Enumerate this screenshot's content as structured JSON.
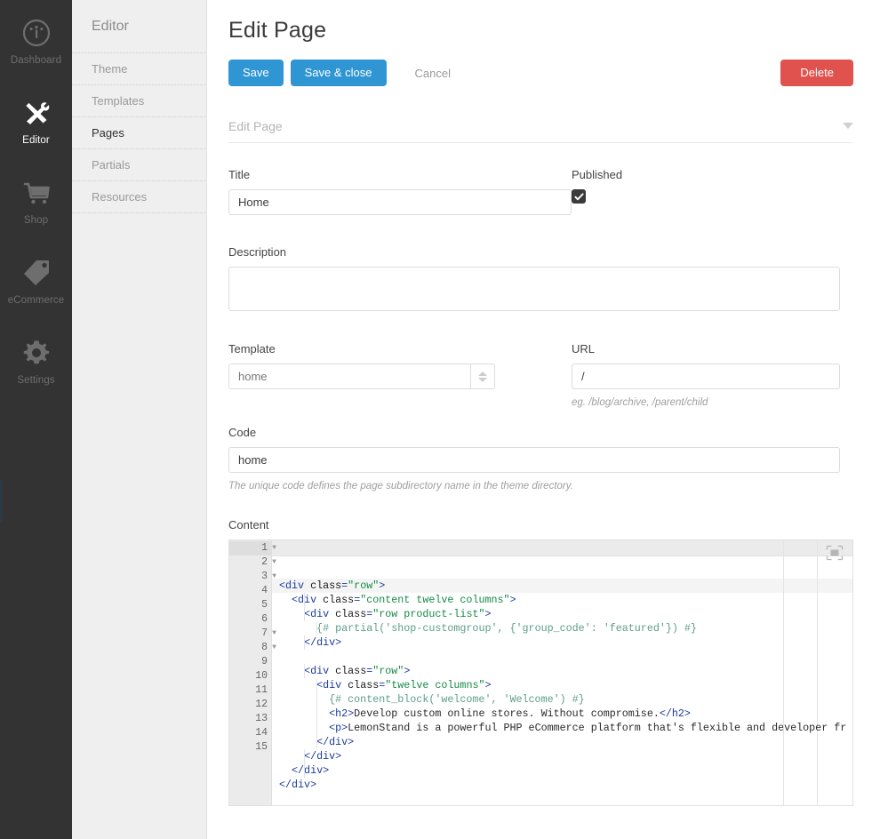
{
  "rail": {
    "items": [
      {
        "label": "Dashboard",
        "icon": "gauge-icon",
        "active": false
      },
      {
        "label": "Editor",
        "icon": "tools-icon",
        "active": true
      },
      {
        "label": "Shop",
        "icon": "cart-icon",
        "active": false
      },
      {
        "label": "eCommerce",
        "icon": "tag-icon",
        "active": false
      },
      {
        "label": "Settings",
        "icon": "gear-icon",
        "active": false
      }
    ]
  },
  "subnav": {
    "title": "Editor",
    "items": [
      {
        "label": "Theme",
        "active": false
      },
      {
        "label": "Templates",
        "active": false
      },
      {
        "label": "Pages",
        "active": true
      },
      {
        "label": "Partials",
        "active": false
      },
      {
        "label": "Resources",
        "active": false
      }
    ]
  },
  "header": {
    "title": "Edit Page"
  },
  "toolbar": {
    "save_label": "Save",
    "save_close_label": "Save & close",
    "cancel_label": "Cancel",
    "delete_label": "Delete"
  },
  "context": {
    "label": "Edit Page",
    "caret": "chevron-down-icon"
  },
  "form": {
    "title": {
      "label": "Title",
      "value": "Home",
      "placeholder": ""
    },
    "published": {
      "label": "Published",
      "checked": true
    },
    "description": {
      "label": "Description",
      "value": "",
      "placeholder": ""
    },
    "template": {
      "label": "Template",
      "value": "home",
      "options": [
        "home"
      ]
    },
    "url": {
      "label": "URL",
      "value": "/",
      "hint": "eg. /blog/archive, /parent/child"
    },
    "code": {
      "label": "Code",
      "value": "home",
      "hint": "The unique code defines the page subdirectory name in the theme directory."
    },
    "content": {
      "label": "Content"
    }
  },
  "editor": {
    "expand_icon": "fullscreen-icon",
    "current_line": 1,
    "line_count": 15,
    "lines": [
      {
        "n": 1,
        "fold": true,
        "indent": 0,
        "tokens": [
          {
            "t": "tag",
            "v": "<div"
          },
          {
            "t": "sp",
            "v": " "
          },
          {
            "t": "attr",
            "v": "class"
          },
          {
            "t": "tag",
            "v": "="
          },
          {
            "t": "str",
            "v": "\"row\""
          },
          {
            "t": "tag",
            "v": ">"
          }
        ]
      },
      {
        "n": 2,
        "fold": true,
        "indent": 1,
        "tokens": [
          {
            "t": "sp",
            "v": "  "
          },
          {
            "t": "tag",
            "v": "<div"
          },
          {
            "t": "sp",
            "v": " "
          },
          {
            "t": "attr",
            "v": "class"
          },
          {
            "t": "tag",
            "v": "="
          },
          {
            "t": "str",
            "v": "\"content twelve columns\""
          },
          {
            "t": "tag",
            "v": ">"
          }
        ]
      },
      {
        "n": 3,
        "fold": true,
        "indent": 2,
        "tokens": [
          {
            "t": "sp",
            "v": "    "
          },
          {
            "t": "tag",
            "v": "<div"
          },
          {
            "t": "sp",
            "v": " "
          },
          {
            "t": "attr",
            "v": "class"
          },
          {
            "t": "tag",
            "v": "="
          },
          {
            "t": "str",
            "v": "\"row product-list\""
          },
          {
            "t": "tag",
            "v": ">"
          }
        ]
      },
      {
        "n": 4,
        "fold": false,
        "indent": 3,
        "tokens": [
          {
            "t": "sp",
            "v": "      "
          },
          {
            "t": "tw",
            "v": "{# partial('shop-customgroup', {'group_code': 'featured'}) #}"
          }
        ]
      },
      {
        "n": 5,
        "fold": false,
        "indent": 2,
        "tokens": [
          {
            "t": "sp",
            "v": "    "
          },
          {
            "t": "tag",
            "v": "</div>"
          }
        ]
      },
      {
        "n": 6,
        "fold": false,
        "indent": 0,
        "tokens": []
      },
      {
        "n": 7,
        "fold": true,
        "indent": 2,
        "tokens": [
          {
            "t": "sp",
            "v": "    "
          },
          {
            "t": "tag",
            "v": "<div"
          },
          {
            "t": "sp",
            "v": " "
          },
          {
            "t": "attr",
            "v": "class"
          },
          {
            "t": "tag",
            "v": "="
          },
          {
            "t": "str",
            "v": "\"row\""
          },
          {
            "t": "tag",
            "v": ">"
          }
        ]
      },
      {
        "n": 8,
        "fold": true,
        "indent": 3,
        "tokens": [
          {
            "t": "sp",
            "v": "      "
          },
          {
            "t": "tag",
            "v": "<div"
          },
          {
            "t": "sp",
            "v": " "
          },
          {
            "t": "attr",
            "v": "class"
          },
          {
            "t": "tag",
            "v": "="
          },
          {
            "t": "str",
            "v": "\"twelve columns\""
          },
          {
            "t": "tag",
            "v": ">"
          }
        ]
      },
      {
        "n": 9,
        "fold": false,
        "indent": 4,
        "tokens": [
          {
            "t": "sp",
            "v": "        "
          },
          {
            "t": "tw",
            "v": "{# content_block('welcome', 'Welcome') #}"
          }
        ]
      },
      {
        "n": 10,
        "fold": false,
        "indent": 4,
        "tokens": [
          {
            "t": "sp",
            "v": "        "
          },
          {
            "t": "tag",
            "v": "<h2>"
          },
          {
            "t": "txt",
            "v": "Develop custom online stores. Without compromise."
          },
          {
            "t": "tag",
            "v": "</h2>"
          }
        ]
      },
      {
        "n": 11,
        "fold": false,
        "indent": 4,
        "tokens": [
          {
            "t": "sp",
            "v": "        "
          },
          {
            "t": "tag",
            "v": "<p>"
          },
          {
            "t": "txt",
            "v": "LemonStand is a powerful PHP eCommerce platform that's flexible and developer fr"
          }
        ]
      },
      {
        "n": 12,
        "fold": false,
        "indent": 3,
        "tokens": [
          {
            "t": "sp",
            "v": "      "
          },
          {
            "t": "tag",
            "v": "</div>"
          }
        ]
      },
      {
        "n": 13,
        "fold": false,
        "indent": 2,
        "tokens": [
          {
            "t": "sp",
            "v": "    "
          },
          {
            "t": "tag",
            "v": "</div>"
          }
        ]
      },
      {
        "n": 14,
        "fold": false,
        "indent": 1,
        "tokens": [
          {
            "t": "sp",
            "v": "  "
          },
          {
            "t": "tag",
            "v": "</div>"
          }
        ]
      },
      {
        "n": 15,
        "fold": false,
        "indent": 0,
        "tokens": [
          {
            "t": "tag",
            "v": "</div>"
          }
        ]
      }
    ]
  },
  "colors": {
    "rail_bg": "#333333",
    "subnav_bg": "#efefef",
    "primary": "#2f95d3",
    "danger": "#e0524e",
    "text": "#3a3a3a",
    "muted": "#9a9a9a"
  }
}
